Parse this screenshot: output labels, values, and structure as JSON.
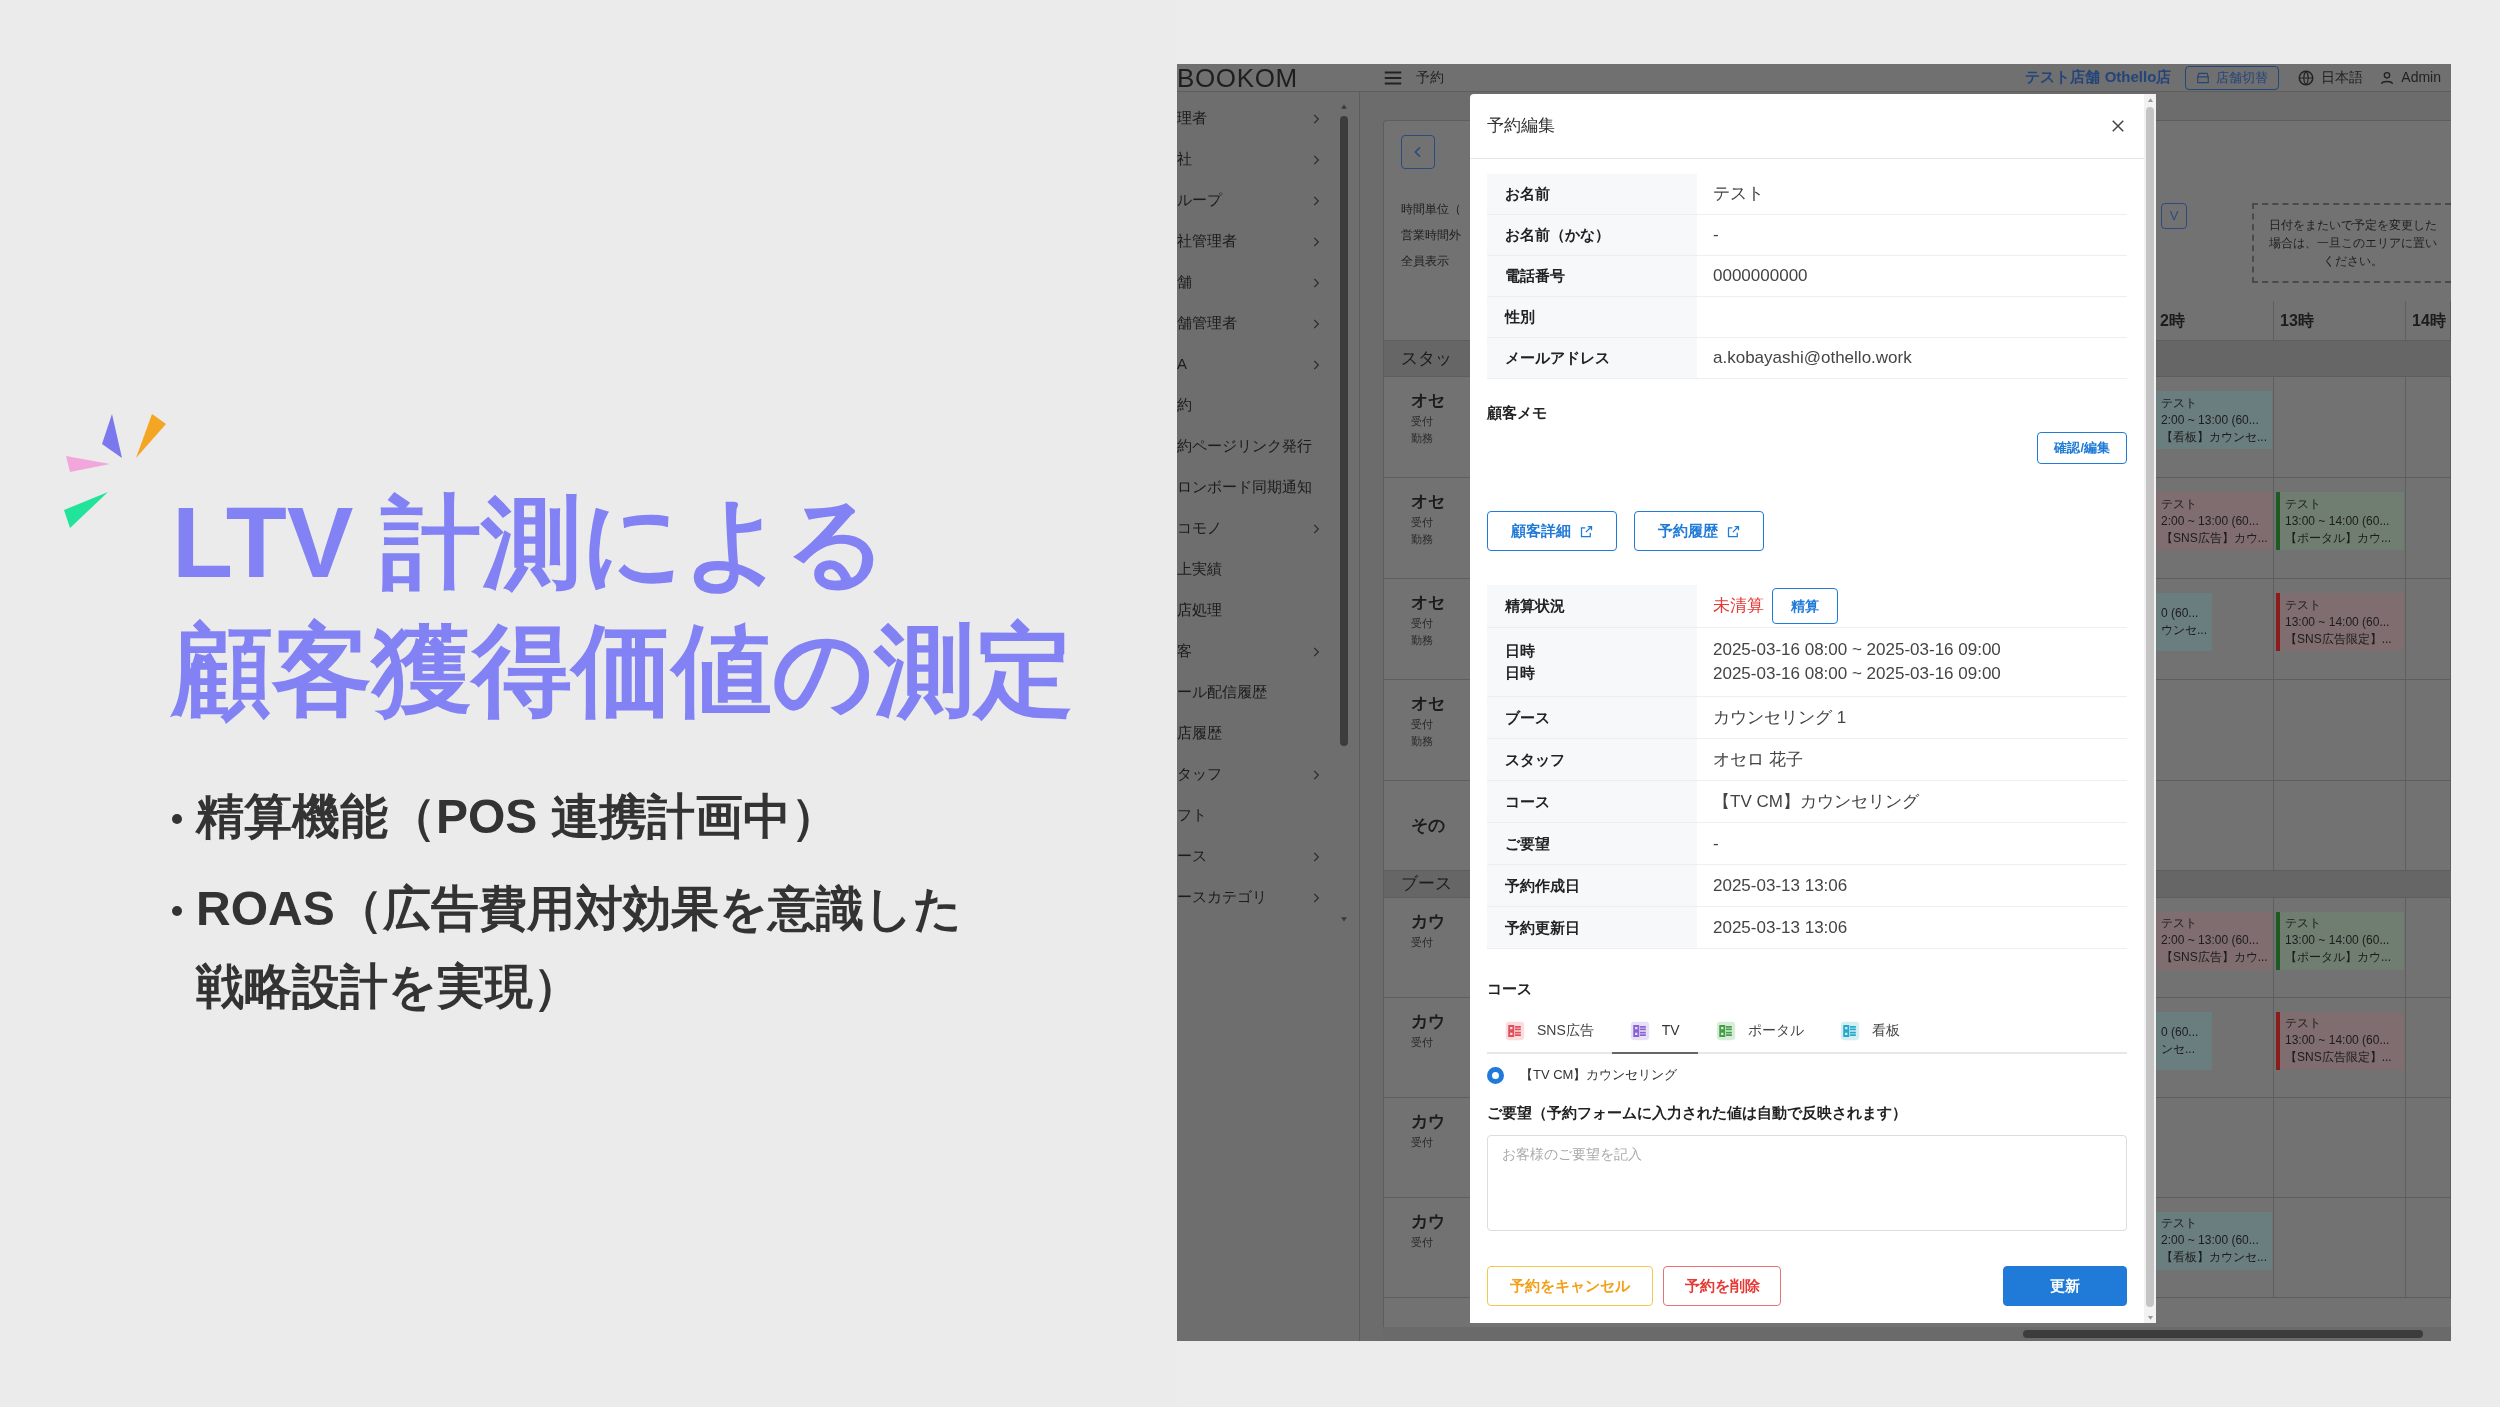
{
  "slide": {
    "title_lines": [
      "LTV 計測による",
      "顧客獲得価値の測定"
    ],
    "bullets": [
      "精算機能（POS 連携計画中）",
      "ROAS（広告費用対効果を意識した戦略設計を実現）"
    ]
  },
  "app": {
    "header": {
      "logo": "BOOKOM",
      "page": "予約",
      "store": "テスト店舗 Othello店",
      "switch_button": "店舗切替",
      "language": "日本語",
      "user": "Admin"
    },
    "sidebar": [
      {
        "label": "理者",
        "expandable": true
      },
      {
        "label": "社",
        "expandable": true
      },
      {
        "label": "ループ",
        "expandable": true
      },
      {
        "label": "社管理者",
        "expandable": true
      },
      {
        "label": "舗",
        "expandable": true
      },
      {
        "label": "舗管理者",
        "expandable": true
      },
      {
        "label": "A",
        "expandable": true
      },
      {
        "label": "約",
        "expandable": false
      },
      {
        "label": "約ページリンク発行",
        "expandable": false
      },
      {
        "label": "ロンボード同期通知",
        "expandable": false
      },
      {
        "label": "コモノ",
        "expandable": true
      },
      {
        "label": "上実績",
        "expandable": false
      },
      {
        "label": "店処理",
        "expandable": false
      },
      {
        "label": "客",
        "expandable": true
      },
      {
        "label": "ール配信履歴",
        "expandable": false
      },
      {
        "label": "店履歴",
        "expandable": false
      },
      {
        "label": "タッフ",
        "expandable": true
      },
      {
        "label": "フト",
        "expandable": false
      },
      {
        "label": "ース",
        "expandable": true
      },
      {
        "label": "ースカテゴリ",
        "expandable": true
      }
    ],
    "toolbar": {
      "labels": [
        "時間単位（",
        "営業時間外",
        "全員表示"
      ],
      "view_button": "V",
      "drop_area": [
        "日付をまたいで予定を変更した",
        "場合は、一旦このエリアに置い",
        "ください。"
      ]
    },
    "hours": [
      "2時",
      "13時",
      "14時"
    ],
    "sections": [
      {
        "label": "スタッ",
        "rows": [
          {
            "name": "オセ",
            "details": [
              "受付",
              "勤務"
            ],
            "columns": [
              [
                {
                  "kind": "full",
                  "color": "#6a7e80",
                  "lines": [
                    "テスト",
                    "2:00 ~ 13:00 (60...",
                    "【看板】カウンセ..."
                  ]
                }
              ],
              []
            ]
          },
          {
            "name": "オセ",
            "details": [
              "受付",
              "勤務"
            ],
            "columns": [
              [
                {
                  "kind": "full",
                  "color": "#806d70",
                  "lines": [
                    "テスト",
                    "2:00 ~ 13:00 (60...",
                    "【SNS広告】カウ..."
                  ]
                }
              ],
              [
                {
                  "kind": "full",
                  "color": "#6f7e70",
                  "bar": {
                    "color": "#1f5a22"
                  },
                  "lines": [
                    "テスト",
                    "13:00 ~ 14:00 (60...",
                    "【ポータル】カウ..."
                  ]
                }
              ]
            ]
          },
          {
            "name": "オセ",
            "details": [
              "受付",
              "勤務"
            ],
            "columns": [
              [
                {
                  "kind": "clipped",
                  "color": "#6a7e80",
                  "lines": [
                    "0 (60...",
                    "ウンセ..."
                  ]
                }
              ],
              [
                {
                  "kind": "full",
                  "color": "#806d70",
                  "bar": {
                    "color": "#8a1c1c"
                  },
                  "lines": [
                    "テスト",
                    "13:00 ~ 14:00 (60...",
                    "【SNS広告限定】..."
                  ]
                }
              ]
            ]
          },
          {
            "name": "オセ",
            "details": [
              "受付",
              "勤務"
            ],
            "columns": []
          },
          {
            "name": "その",
            "details": [],
            "columns": []
          }
        ]
      },
      {
        "label": "ブース",
        "rows": [
          {
            "name": "カウ",
            "details": [
              "受付"
            ],
            "columns": [
              [
                {
                  "kind": "full",
                  "color": "#806d70",
                  "lines": [
                    "テスト",
                    "2:00 ~ 13:00 (60...",
                    "【SNS広告】カウ..."
                  ]
                }
              ],
              [
                {
                  "kind": "full",
                  "color": "#6f7e70",
                  "bar": {
                    "color": "#1f5a22"
                  },
                  "lines": [
                    "テスト",
                    "13:00 ~ 14:00 (60...",
                    "【ポータル】カウ..."
                  ]
                }
              ]
            ]
          },
          {
            "name": "カウ",
            "details": [
              "受付"
            ],
            "columns": [
              [
                {
                  "kind": "clipped",
                  "color": "#6a7e80",
                  "lines": [
                    "0 (60...",
                    "ンセ..."
                  ]
                }
              ],
              [
                {
                  "kind": "full",
                  "color": "#806d70",
                  "bar": {
                    "color": "#8a1c1c"
                  },
                  "lines": [
                    "テスト",
                    "13:00 ~ 14:00 (60...",
                    "【SNS広告限定】..."
                  ]
                }
              ]
            ]
          },
          {
            "name": "カウ",
            "details": [
              "受付"
            ],
            "columns": []
          },
          {
            "name": "カウ",
            "details": [
              "受付"
            ],
            "columns": [
              [
                {
                  "kind": "full",
                  "color": "#6a7e80",
                  "lines": [
                    "テスト",
                    "2:00 ~ 13:00 (60...",
                    "【看板】カウンセ..."
                  ]
                }
              ],
              []
            ]
          }
        ]
      }
    ]
  },
  "modal": {
    "title": "予約編集",
    "customer_rows": [
      {
        "label": "お名前",
        "value": "テスト"
      },
      {
        "label": "お名前（かな）",
        "value": "-"
      },
      {
        "label": "電話番号",
        "value": "0000000000"
      },
      {
        "label": "性別"
      },
      {
        "label": "メールアドレス",
        "value": "a.kobayashi@othello.work"
      }
    ],
    "memo": {
      "label": "顧客メモ",
      "button": "確認/編集"
    },
    "links": [
      "顧客詳細",
      "予約履歴"
    ],
    "settlement": {
      "label": "精算状況",
      "status": "未清算",
      "settled": false,
      "button": "精算"
    },
    "booking_rows": [
      {
        "labels": [
          "日時",
          "日時"
        ],
        "values": [
          "2025-03-16 08:00 ~ 2025-03-16 09:00",
          "2025-03-16 08:00 ~ 2025-03-16 09:00"
        ]
      },
      {
        "labels": [
          "ブース"
        ],
        "values": [
          "カウンセリング 1"
        ]
      },
      {
        "labels": [
          "スタッフ"
        ],
        "values": [
          "オセロ 花子"
        ]
      },
      {
        "labels": [
          "コース"
        ],
        "values": [
          "【TV CM】カウンセリング"
        ]
      },
      {
        "labels": [
          "ご要望"
        ],
        "values": [
          "-"
        ]
      },
      {
        "labels": [
          "予約作成日"
        ],
        "values": [
          "2025-03-13 13:06"
        ]
      },
      {
        "labels": [
          "予約更新日"
        ],
        "values": [
          "2025-03-13 13:06"
        ]
      }
    ],
    "course": {
      "heading": "コース",
      "tabs": [
        {
          "label": "SNS広告",
          "color": "#e0505c",
          "selected": false
        },
        {
          "label": "TV",
          "color": "#8a63d2",
          "selected": true
        },
        {
          "label": "ポータル",
          "color": "#43a047",
          "selected": false
        },
        {
          "label": "看板",
          "color": "#26a9c9",
          "selected": false
        }
      ],
      "options": [
        {
          "label": "【TV CM】カウンセリング",
          "selected": true
        }
      ]
    },
    "request": {
      "label": "ご要望（予約フォームに入力された値は自動で反映されます）",
      "placeholder": "お客様のご要望を記入"
    },
    "footer": [
      {
        "kind": "warning",
        "label": "予約をキャンセル"
      },
      {
        "kind": "danger",
        "label": "予約を削除"
      },
      {
        "kind": "primary",
        "label": "更新"
      }
    ]
  }
}
